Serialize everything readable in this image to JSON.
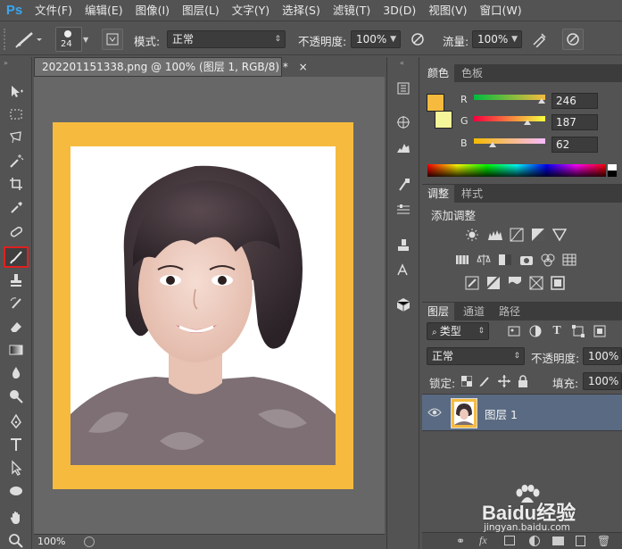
{
  "app": {
    "logo": "Ps"
  },
  "menu": [
    "文件(F)",
    "编辑(E)",
    "图像(I)",
    "图层(L)",
    "文字(Y)",
    "选择(S)",
    "滤镜(T)",
    "3D(D)",
    "视图(V)",
    "窗口(W)"
  ],
  "options": {
    "brush_size": "24",
    "mode_label": "模式:",
    "mode_value": "正常",
    "opacity_label": "不透明度:",
    "opacity_value": "100%",
    "flow_label": "流量:",
    "flow_value": "100%"
  },
  "document": {
    "tab_title": "202201151338.png @ 100% (图层 1, RGB/8) *",
    "close": "×",
    "zoom": "100%",
    "frame_color": "#F6BB3E"
  },
  "color_panel": {
    "tabs": [
      "颜色",
      "色板"
    ],
    "r_label": "R",
    "g_label": "G",
    "b_label": "B",
    "r": "246",
    "g": "187",
    "b": "62",
    "fg_color": "#F6BB3E",
    "bg_color": "#F5F59A"
  },
  "adjust_panel": {
    "tabs": [
      "调整",
      "样式"
    ],
    "title": "添加调整"
  },
  "layers_panel": {
    "tabs": [
      "图层",
      "通道",
      "路径"
    ],
    "filter_kind": "类型",
    "blend_mode": "正常",
    "opacity_label": "不透明度:",
    "opacity_value": "100%",
    "lock_label": "锁定:",
    "fill_label": "填充:",
    "fill_value": "100%",
    "layers": [
      {
        "name": "图层 1"
      }
    ]
  },
  "watermark": {
    "text": "Baidu经验",
    "sub": "jingyan.baidu.com"
  }
}
